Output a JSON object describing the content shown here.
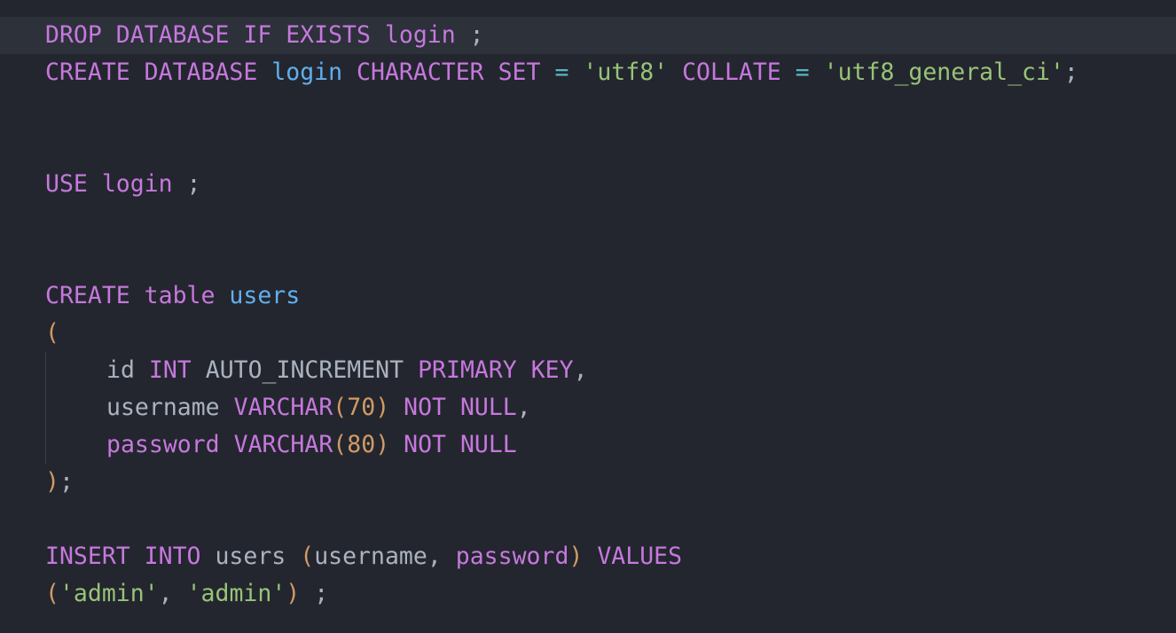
{
  "colors": {
    "background": "#23262e",
    "current_line": "#2c313a",
    "indent_guide": "#3b4048",
    "keyword": "#c678dd",
    "identifier": "#61afef",
    "string": "#98c379",
    "number": "#d19a66",
    "operator": "#56b6c2",
    "plain": "#abb2bf"
  },
  "lines": {
    "l1": {
      "drop": "DROP DATABASE IF EXISTS login",
      "semi": " ;"
    },
    "l2": {
      "create_database": "CREATE DATABASE",
      "db_name": "login",
      "character_set": "CHARACTER SET",
      "eq1": "=",
      "charset_value": "'utf8'",
      "collate": "COLLATE",
      "eq2": "=",
      "collate_value": "'utf8_general_ci'",
      "semi": ";"
    },
    "l3": {
      "use": "USE login",
      "semi": " ;"
    },
    "l4": {
      "create": "CREATE table",
      "table_name": "users"
    },
    "l5": {
      "open_paren": "("
    },
    "l6": {
      "col": "id",
      "type": "INT",
      "auto_increment": "AUTO_INCREMENT",
      "primary_key": "PRIMARY KEY",
      "comma": ","
    },
    "l7": {
      "col": "username",
      "type": "VARCHAR",
      "open": "(",
      "size": "70",
      "close": ")",
      "not_null": "NOT NULL",
      "comma": ","
    },
    "l8": {
      "col": "password",
      "type": "VARCHAR",
      "open": "(",
      "size": "80",
      "close": ")",
      "not_null": "NOT NULL"
    },
    "l9": {
      "close_paren": ")",
      "semi": ";"
    },
    "l10": {
      "insert_into": "INSERT INTO",
      "table": "users",
      "open": "(",
      "col1": "username",
      "comma": ",",
      "col2": "password",
      "close": ")",
      "values": "VALUES"
    },
    "l11": {
      "open": "(",
      "val1": "'admin'",
      "comma": ",",
      "val2": "'admin'",
      "close": ")",
      "semi": " ;"
    }
  }
}
